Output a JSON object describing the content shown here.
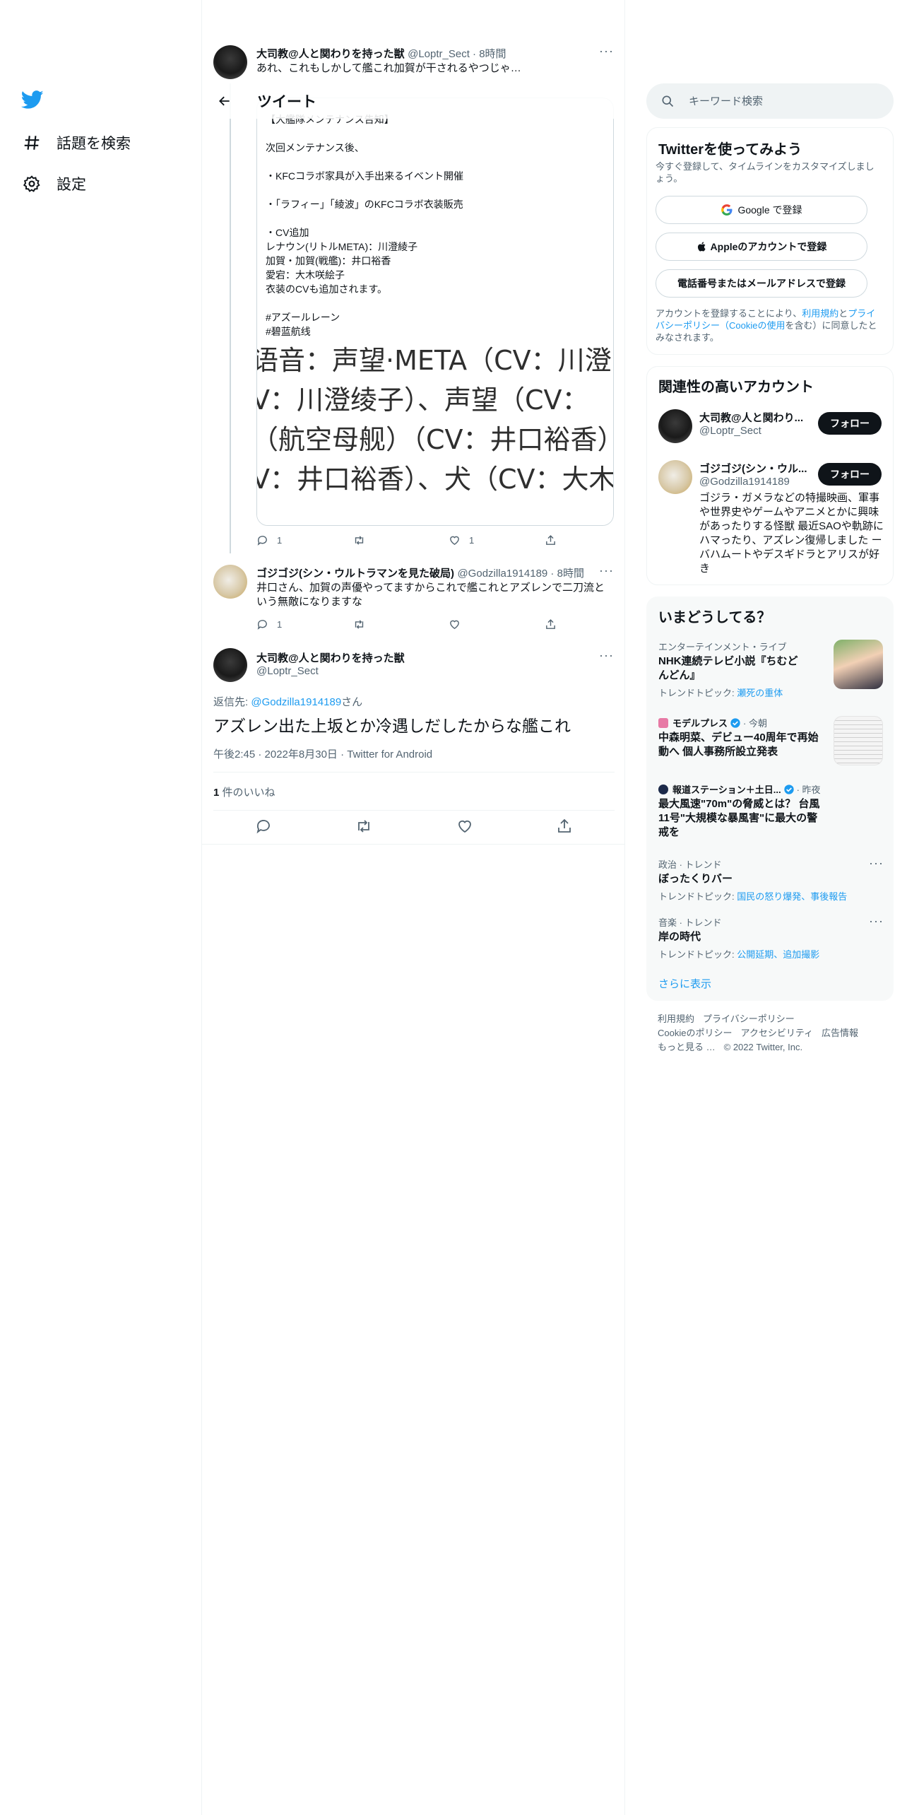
{
  "nav": {
    "items": [
      {
        "label": "話題を検索",
        "icon": "hash-icon"
      },
      {
        "label": "設定",
        "icon": "gear-icon"
      }
    ]
  },
  "header": {
    "title": "ツイート"
  },
  "parent_tweet": {
    "name": "大司教@人と関わりを持った獣",
    "meta": "@Loptr_Sect · 8時間",
    "text": "あれ、これもしかして艦これ加賀が干されるやつじゃ…",
    "quote_text": "【大艦隊メンテナンス告知】\n\n次回メンテナンス後、\n\n・KFCコラボ家具が入手出来るイベント開催\n\n・「ラフィー」「綾波」のKFCコラボ衣装販売\n\n・CV追加\nレナウン(リトルMETA)：川澄綾子\n加賀・加賀(戦艦)：井口裕香\n愛宕：大木咲絵子\n衣装のCVも追加されます。\n\n#アズールレーン\n#碧蓝航线",
    "image_lines": [
      "语音：声望·META（CV：川澄",
      "V：川澄绫子）、声望（CV：",
      "（航空母舰）（CV：井口裕香）",
      "V：井口裕香）、犬（CV：大木"
    ],
    "reply_count": "1",
    "retweet_count": "",
    "like_count": "1"
  },
  "reply_tweet": {
    "name": "ゴジゴジ(シン・ウルトラマンを見た破局)",
    "meta": "@Godzilla1914189 · 8時間",
    "text": "井口さん、加賀の声優やってますからこれで艦これとアズレンで二刀流という無敵になりますな",
    "reply_count": "1"
  },
  "main_tweet": {
    "name": "大司教@人と関わりを持った獣",
    "handle": "@Loptr_Sect",
    "reply_to_prefix": "返信先: ",
    "reply_to_handle": "@Godzilla1914189",
    "reply_to_suffix": "さん",
    "text": "アズレン出た上坂とか冷遇しだしたからな艦これ",
    "timestamp": "午後2:45 · 2022年8月30日 · Twitter for Android",
    "likes_count": "1",
    "likes_label": " 件のいいね"
  },
  "search": {
    "placeholder": "キーワード検索"
  },
  "signup": {
    "title": "Twitterを使ってみよう",
    "subtitle": "今すぐ登録して、タイムラインをカスタマイズしましょう。",
    "google_label": "Google で登録",
    "apple_label": "Appleのアカウントで登録",
    "phone_label": "電話番号またはメールアドレスで登録",
    "terms_prefix": "アカウントを登録することにより、",
    "terms_link": "利用規約",
    "terms_and": "と",
    "privacy_link": "プライバシーポリシー（Cookieの使用",
    "terms_suffix": "を含む）に同意したとみなされます。"
  },
  "related": {
    "title": "関連性の高いアカウント",
    "accounts": [
      {
        "name": "大司教@人と関わり...",
        "handle": "@Loptr_Sect",
        "follow": "フォロー",
        "bio": ""
      },
      {
        "name": "ゴジゴジ(シン・ウル...",
        "handle": "@Godzilla1914189",
        "follow": "フォロー",
        "bio": "ゴジラ・ガメラなどの特撮映画、軍事や世界史やゲームやアニメとかに興味があったりする怪獣 最近SAOや軌跡にハマったり、アズレン復帰しました ー バハムートやデスギドラとアリスが好き"
      }
    ]
  },
  "trends": {
    "title": "いまどうしてる？",
    "items": [
      {
        "category": "エンターテインメント・ライブ",
        "name": "NHK連続テレビ小説『ちむどんどん』",
        "topic_prefix": "トレンドトピック: ",
        "topic": "瀬死の重体"
      },
      {
        "category": "モデルプレス",
        "category_suffix": " · 今朝",
        "name": "中森明菜、デビュー40周年で再始動へ 個人事務所設立発表"
      },
      {
        "category": "報道ステーション＋土日...",
        "category_suffix": " · 昨夜",
        "name": "最大風速\"70m\"の脅威とは？ 台風11号\"大規模な暴風害\"に最大の警戒を"
      },
      {
        "category": "政治 · トレンド",
        "name": "ぼったくりバー",
        "topic_prefix": "トレンドトピック: ",
        "topic": "国民の怒り爆発、事後報告"
      },
      {
        "category": "音楽 · トレンド",
        "name": "岸の時代",
        "topic_prefix": "トレンドトピック: ",
        "topic": "公開延期、追加撮影"
      }
    ],
    "show_more": "さらに表示"
  },
  "footer": {
    "links": [
      "利用規約",
      "プライバシーポリシー",
      "Cookieのポリシー",
      "アクセシビリティ",
      "広告情報",
      "もっと見る …"
    ],
    "copyright": "© 2022 Twitter, Inc."
  },
  "colors": {
    "accent": "#1d9bf0",
    "text": "#0f1419",
    "secondary": "#536471",
    "border": "#eff3f4"
  }
}
